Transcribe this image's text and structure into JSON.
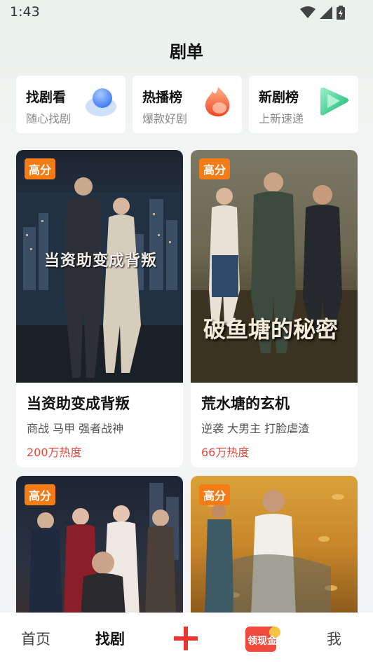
{
  "status": {
    "time": "1:43"
  },
  "page": {
    "title": "剧单"
  },
  "categories": [
    {
      "name": "找剧看",
      "sub": "随心找剧",
      "icon": "blue-circle-icon",
      "color": "#5b8df5"
    },
    {
      "name": "热播榜",
      "sub": "爆款好剧",
      "icon": "flame-icon",
      "color": "#f56a3a"
    },
    {
      "name": "新剧榜",
      "sub": "上新速递",
      "icon": "play-triangle-icon",
      "color": "#2fcf8a"
    }
  ],
  "dramas": [
    {
      "badge": "高分",
      "poster_text": "当资助变成背叛",
      "title": "当资助变成背叛",
      "tags": "商战 马甲 强者战神",
      "heat": "200万热度"
    },
    {
      "badge": "高分",
      "poster_text": "破鱼塘的秘密",
      "title": "荒水塘的玄机",
      "tags": "逆袭 大男主 打脸虐渣",
      "heat": "66万热度"
    },
    {
      "badge": "高分"
    },
    {
      "badge": "高分"
    }
  ],
  "nav": {
    "home": "首页",
    "find": "找剧",
    "reward": "领现金",
    "me": "我"
  }
}
